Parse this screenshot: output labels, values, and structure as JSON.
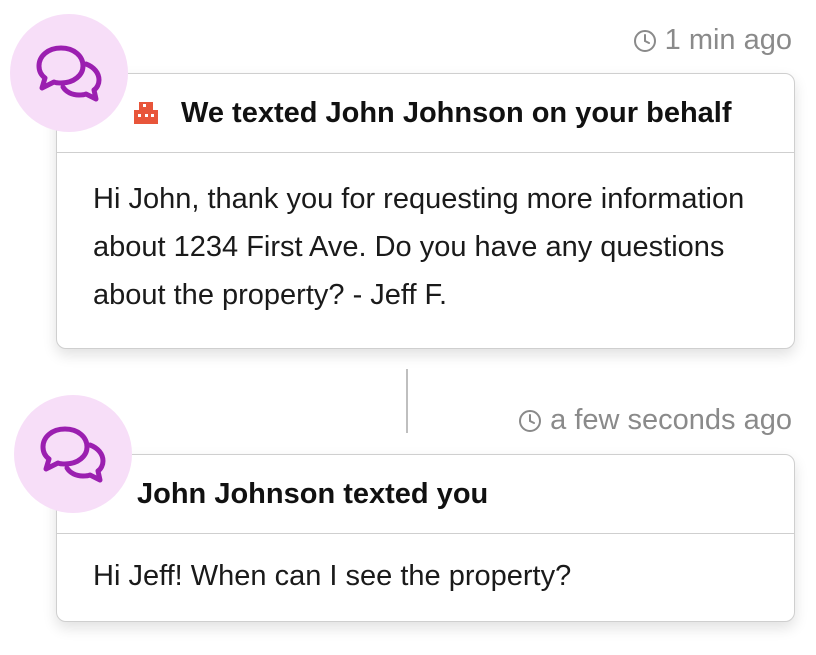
{
  "events": [
    {
      "timestamp": "1 min ago",
      "title": "We texted John Johnson on your behalf",
      "message": "Hi John, thank you for requesting more information about 1234 First Ave. Do you have any questions about the property? - Jeff F."
    },
    {
      "timestamp": "a few seconds ago",
      "title": "John Johnson texted you",
      "message": "Hi Jeff! When can I see the property?"
    }
  ],
  "icons": {
    "avatar": "chat-bubbles-icon",
    "timestamp": "clock-icon",
    "sender": "building-icon"
  },
  "colors": {
    "avatar_bg": "#f7def8",
    "chat_icon": "#9b1fb0",
    "building_icon": "#e8553a",
    "timestamp_text": "#8a8a8a"
  }
}
